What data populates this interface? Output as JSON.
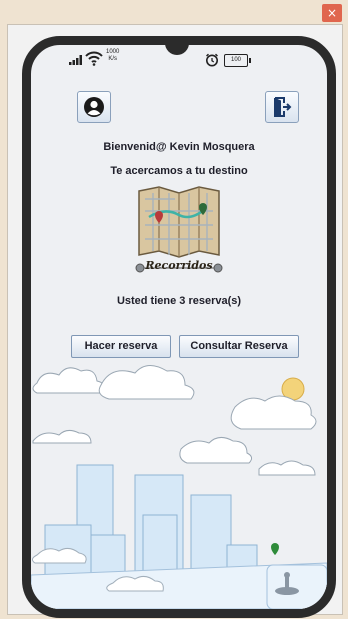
{
  "window": {
    "close_glyph": "×"
  },
  "status_bar": {
    "speed_value": "1000",
    "speed_unit": "K/s",
    "battery": "100"
  },
  "main": {
    "welcome": "Bienvenid@ Kevin Mosquera",
    "tagline": "Te acercamos a tu destino",
    "logo_text": "Recorridos",
    "reservations": "Usted tiene 3 reserva(s)"
  },
  "buttons": {
    "reserve": "Hacer reserva",
    "consult": "Consultar Reserva"
  },
  "icons": {
    "profile": "user-circle-icon",
    "exit": "exit-door-icon"
  },
  "colors": {
    "phone_border": "#2b2b2b",
    "screen_bg": "#eef0f3",
    "close_red": "#e0664e",
    "button_border": "#7f97b5"
  }
}
